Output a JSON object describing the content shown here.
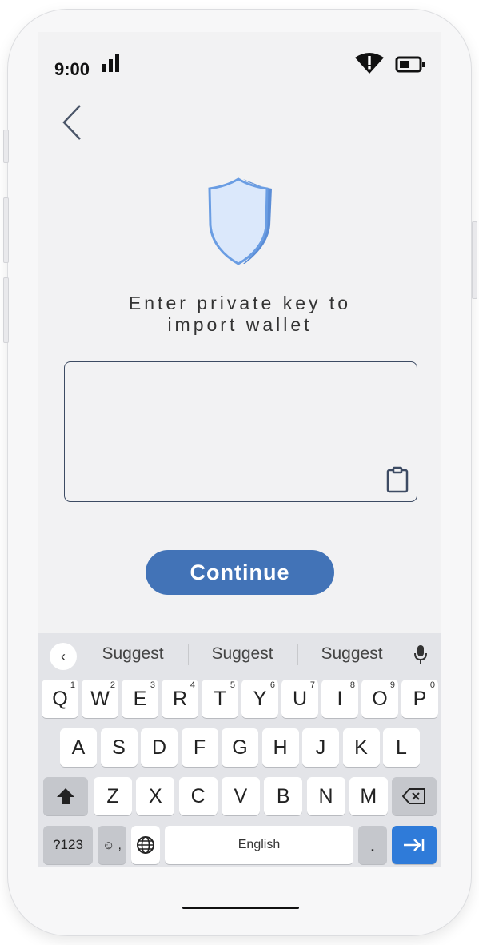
{
  "status_bar": {
    "time": "9:00",
    "icons": [
      "signal-icon",
      "wifi-alert-icon",
      "battery-icon"
    ]
  },
  "nav": {
    "back_icon": "chevron-left-icon"
  },
  "main": {
    "icon": "shield-icon",
    "title_line1": "Enter private key to",
    "title_line2": "import wallet",
    "input_value": "",
    "paste_icon": "clipboard-icon",
    "continue_label": "Continue"
  },
  "keyboard": {
    "suggestions": [
      "Suggest",
      "Suggest",
      "Suggest"
    ],
    "row1": [
      {
        "label": "Q",
        "num": "1"
      },
      {
        "label": "W",
        "num": "2"
      },
      {
        "label": "E",
        "num": "3"
      },
      {
        "label": "R",
        "num": "4"
      },
      {
        "label": "T",
        "num": "5"
      },
      {
        "label": "Y",
        "num": "6"
      },
      {
        "label": "U",
        "num": "7"
      },
      {
        "label": "I",
        "num": "8"
      },
      {
        "label": "O",
        "num": "9"
      },
      {
        "label": "P",
        "num": "0"
      }
    ],
    "row2": [
      "A",
      "S",
      "D",
      "F",
      "G",
      "H",
      "J",
      "K",
      "L"
    ],
    "row3": [
      "Z",
      "X",
      "C",
      "V",
      "B",
      "N",
      "M"
    ],
    "symbols_label": "?123",
    "emoji_comma": "☺ ,",
    "space_label": "English",
    "period_label": ".",
    "colors": {
      "accent": "#2f7bd9",
      "button": "#4273b7"
    }
  }
}
